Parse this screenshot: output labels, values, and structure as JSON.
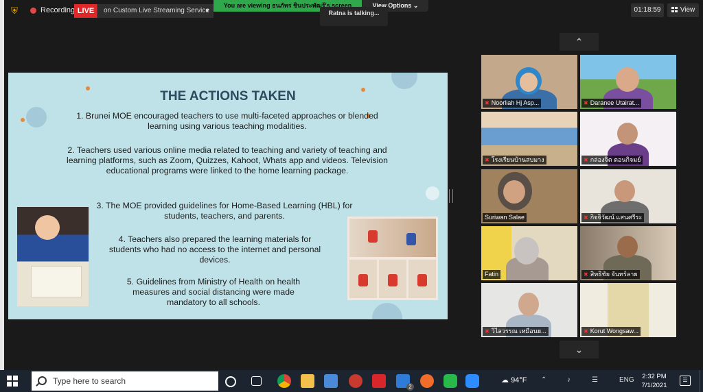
{
  "topbar": {
    "recording_label": "Recording",
    "live_label": "LIVE",
    "stream_label": "on Custom Live Streaming Service",
    "viewing_banner": "You are viewing ธนภัทร ชินประพัฒรู้'s screen",
    "view_options_label": "View Options",
    "talking_label": "Ratna is talking...",
    "timer": "01:18:59",
    "view_label": "View"
  },
  "slide": {
    "title": "THE ACTIONS TAKEN",
    "point1": "1. Brunei MOE encouraged teachers to use multi-faceted approaches or blended learning using various teaching modalities.",
    "point2": "2. Teachers used various online media related to teaching and variety of teaching and learning platforms, such as Zoom, Quizzes, Kahoot, Whats app and videos. Television educational programs were linked to the home learning package.",
    "point3": "3. The MOE provided guidelines for Home-Based Learning (HBL) for students, teachers, and parents.",
    "point4": "4. Teachers also prepared the learning materials for students who had no access to the internet and personal devices.",
    "point5": "5. Guidelines from Ministry of Health on health measures and social distancing were made mandatory to all schools."
  },
  "participants": [
    {
      "name": "Noorliah Hj Asp..."
    },
    {
      "name": "Daranee Utairat..."
    },
    {
      "name": "โรงเรียนบ้านสบมาง"
    },
    {
      "name": "กล่องจิต ตอนกิจมย์"
    },
    {
      "name": "Suriwan Salae"
    },
    {
      "name": "กิจจิวัฒน์ แสนศรีระ"
    },
    {
      "name": "Fatin"
    },
    {
      "name": "สิทธิชัย จันทร์ลาย"
    },
    {
      "name": "วิไลวรรณ เหมือนย..."
    },
    {
      "name": "Korut Wongsaw..."
    }
  ],
  "taskbar": {
    "search_placeholder": "Type here to search",
    "temperature": "94°F",
    "language": "ENG",
    "time": "2:32 PM",
    "date": "7/1/2021",
    "mail_badge": "2"
  },
  "icons": {
    "shield": "shield-icon",
    "record": "record-dot-icon",
    "grid": "grid-icon",
    "chevron_up": "chevron-up-icon",
    "chevron_down": "chevron-down-icon",
    "muted_mic": "muted-mic-icon"
  },
  "colors": {
    "live": "#e02828",
    "viewing_banner": "#2ea84a",
    "slide_bg": "#bfe1e8",
    "title": "#2d4a5e",
    "taskbar": "#1c2430"
  }
}
